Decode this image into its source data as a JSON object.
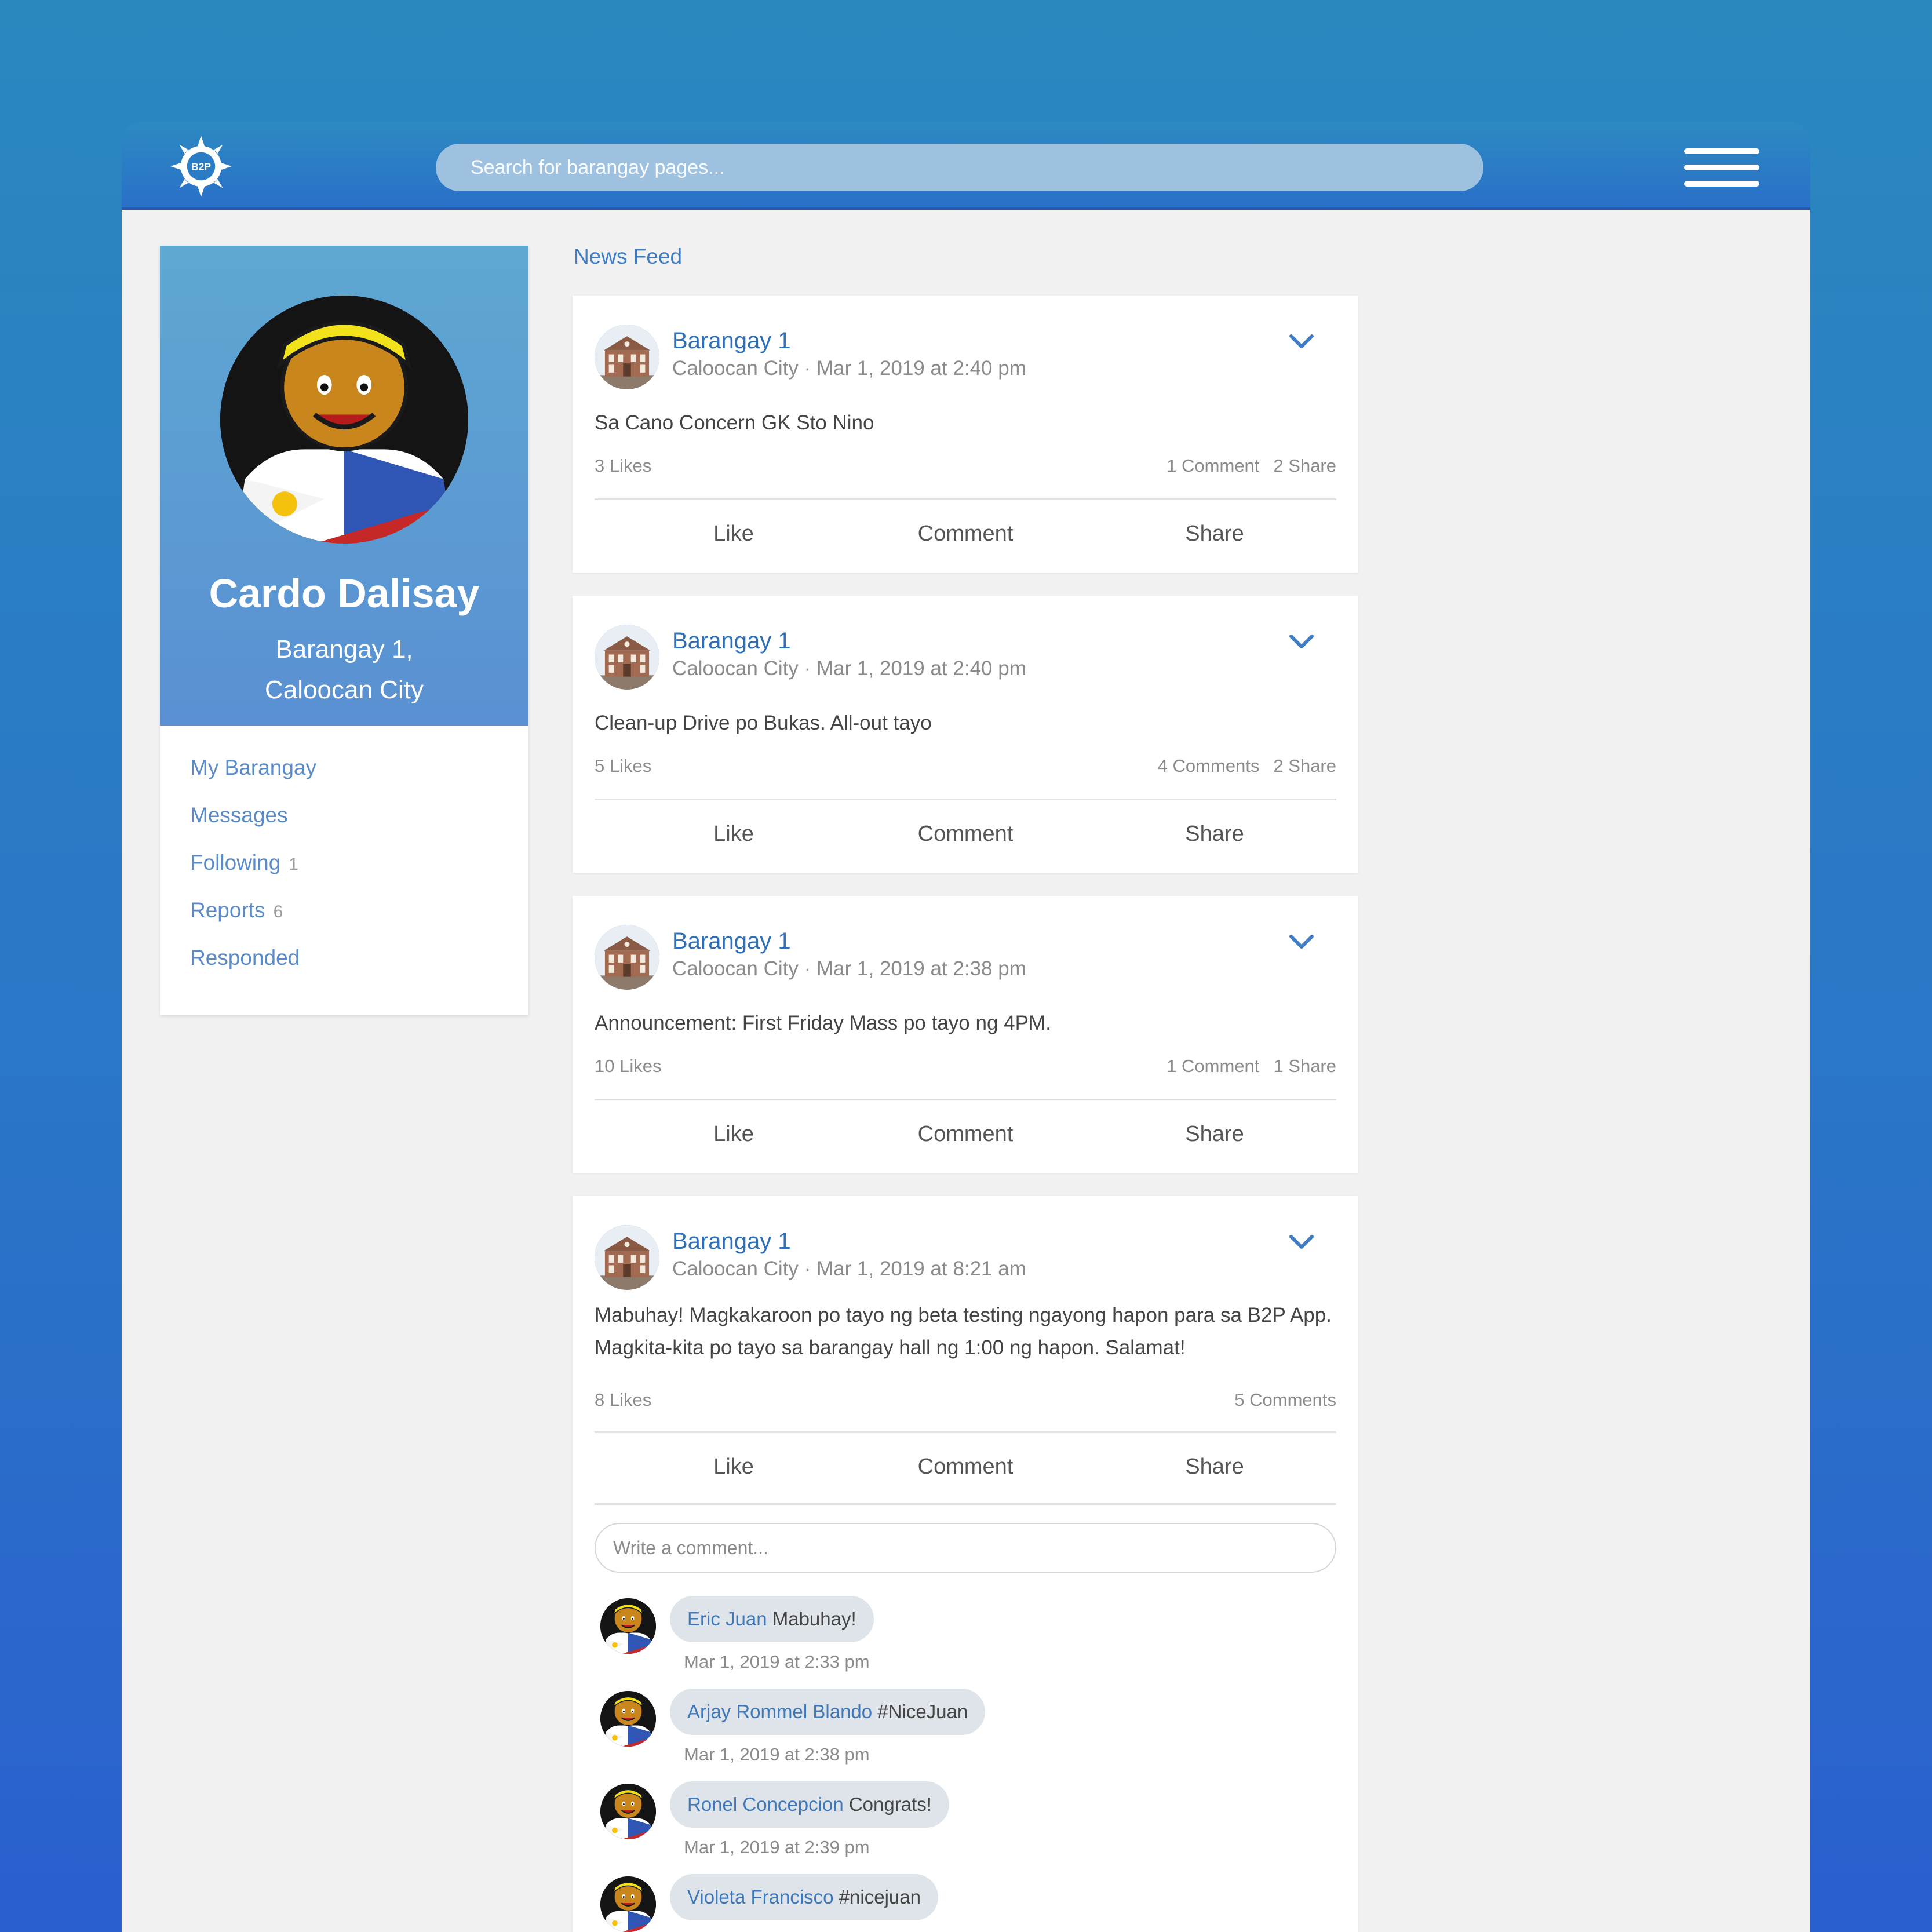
{
  "header": {
    "logo_icon": "b2p-sun-gear-logo",
    "logo_text": "B2P",
    "search_placeholder": "Search for barangay pages...",
    "menu_icon": "hamburger-menu-icon"
  },
  "profile": {
    "name": "Cardo Dalisay",
    "location_line1": "Barangay 1,",
    "location_line2": "Caloocan City",
    "nav": [
      {
        "label": "My Barangay",
        "count": ""
      },
      {
        "label": "Messages",
        "count": ""
      },
      {
        "label": "Following",
        "count": "1"
      },
      {
        "label": "Reports",
        "count": "6"
      },
      {
        "label": "Responded",
        "count": ""
      }
    ]
  },
  "feed": {
    "title": "News Feed",
    "actions": {
      "like": "Like",
      "comment": "Comment",
      "share": "Share"
    },
    "posts": [
      {
        "author": "Barangay 1",
        "meta": "Caloocan City · Mar 1, 2019 at 2:40 pm",
        "text": "Sa Cano Concern GK Sto Nino",
        "likes": "3 Likes",
        "comments": "1 Comment",
        "shares": "2 Share"
      },
      {
        "author": "Barangay 1",
        "meta": "Caloocan City · Mar 1, 2019 at 2:40 pm",
        "text": "Clean-up Drive po Bukas. All-out tayo",
        "likes": "5 Likes",
        "comments": "4 Comments",
        "shares": "2 Share"
      },
      {
        "author": "Barangay 1",
        "meta": "Caloocan City · Mar 1, 2019 at 2:38 pm",
        "text": "Announcement: First Friday Mass po tayo ng 4PM.",
        "likes": "10 Likes",
        "comments": "1 Comment",
        "shares": "1 Share"
      },
      {
        "author": "Barangay 1",
        "meta": "Caloocan City · Mar 1, 2019 at 8:21 am",
        "text": "Mabuhay! Magkakaroon po tayo ng beta testing ngayong hapon para sa B2P App. Magkita-kita po tayo sa barangay hall ng 1:00 ng hapon. Salamat!",
        "likes": "8 Likes",
        "comments": "5 Comments",
        "shares": "",
        "comment_placeholder": "Write a comment...",
        "comment_list": [
          {
            "name": "Eric Juan",
            "text": "Mabuhay!",
            "time": "Mar 1, 2019 at 2:33 pm"
          },
          {
            "name": "Arjay Rommel Blando",
            "text": "#NiceJuan",
            "time": "Mar 1, 2019 at 2:38 pm"
          },
          {
            "name": "Ronel Concepcion",
            "text": "Congrats!",
            "time": "Mar 1, 2019 at 2:39 pm"
          },
          {
            "name": "Violeta Francisco",
            "text": "#nicejuan",
            "time": ""
          }
        ]
      }
    ]
  },
  "colors": {
    "background_top": "#2a88bf",
    "background_bottom": "#2a5fce",
    "panel": "#f1f1f1",
    "link": "#2f6fb8",
    "muted": "#8b8b8b"
  }
}
